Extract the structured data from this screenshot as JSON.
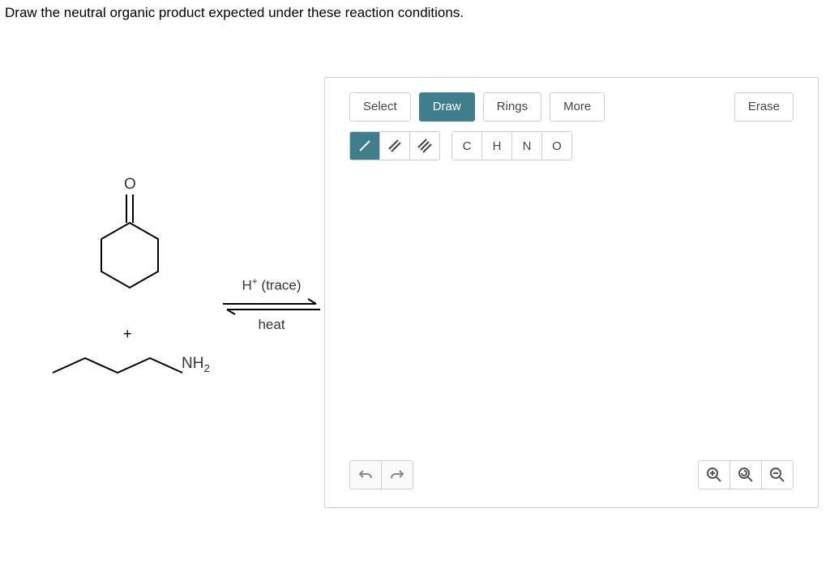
{
  "prompt": "Draw the neutral organic product expected under these reaction conditions.",
  "toolbar": {
    "tabs": {
      "select": "Select",
      "draw": "Draw",
      "rings": "Rings",
      "more": "More",
      "erase": "Erase"
    },
    "atoms": {
      "c": "C",
      "h": "H",
      "n": "N",
      "o": "O"
    }
  },
  "reaction": {
    "plus": "+",
    "cond_top": "H⁺ (trace)",
    "cond_bot": "heat",
    "amine_label": "NH₂",
    "ketone_O": "O"
  },
  "icons": {
    "undo": "undo-icon",
    "redo": "redo-icon",
    "zoom_in": "zoom-in-icon",
    "zoom_reset": "zoom-reset-icon",
    "zoom_out": "zoom-out-icon"
  }
}
